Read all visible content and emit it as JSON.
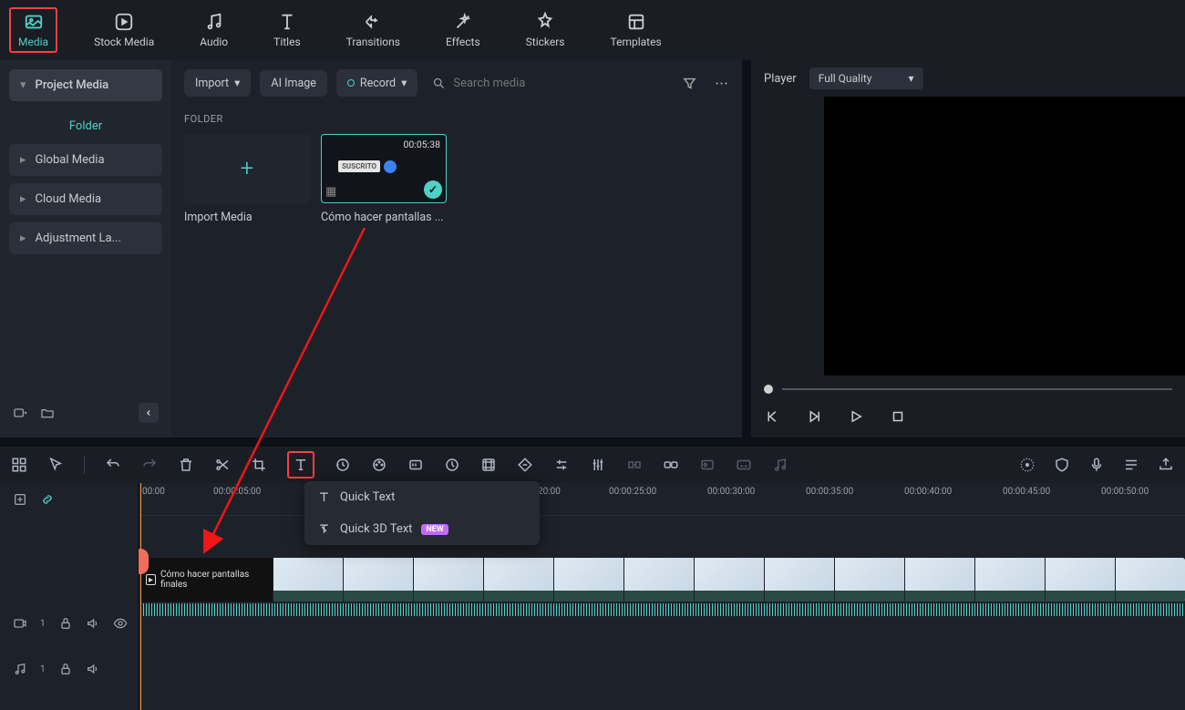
{
  "top_tabs": {
    "media": "Media",
    "stock_media": "Stock Media",
    "audio": "Audio",
    "titles": "Titles",
    "transitions": "Transitions",
    "effects": "Effects",
    "stickers": "Stickers",
    "templates": "Templates"
  },
  "sidebar": {
    "project_media": "Project Media",
    "folder": "Folder",
    "global_media": "Global Media",
    "cloud_media": "Cloud Media",
    "adjustment": "Adjustment La..."
  },
  "media_toolbar": {
    "import": "Import",
    "ai_image": "AI Image",
    "record": "Record",
    "search_placeholder": "Search media"
  },
  "media": {
    "section": "FOLDER",
    "import_media": "Import Media",
    "clip1": {
      "duration": "00:05:38",
      "badge": "SUSCRITO",
      "name": "Cómo hacer pantallas ..."
    }
  },
  "player": {
    "title": "Player",
    "quality": "Full Quality"
  },
  "popup": {
    "quick_text": "Quick Text",
    "quick_3d_text": "Quick 3D Text",
    "new": "NEW"
  },
  "timeline": {
    "clip_title": "Cómo hacer pantallas finales",
    "track_video_badge": "1",
    "track_audio_badge": "1",
    "timecodes": [
      "00:00",
      "00:00:05:00",
      "20:00",
      "00:00:25:00",
      "00:00:30:00",
      "00:00:35:00",
      "00:00:40:00",
      "00:00:45:00",
      "00:00:50:00"
    ]
  }
}
